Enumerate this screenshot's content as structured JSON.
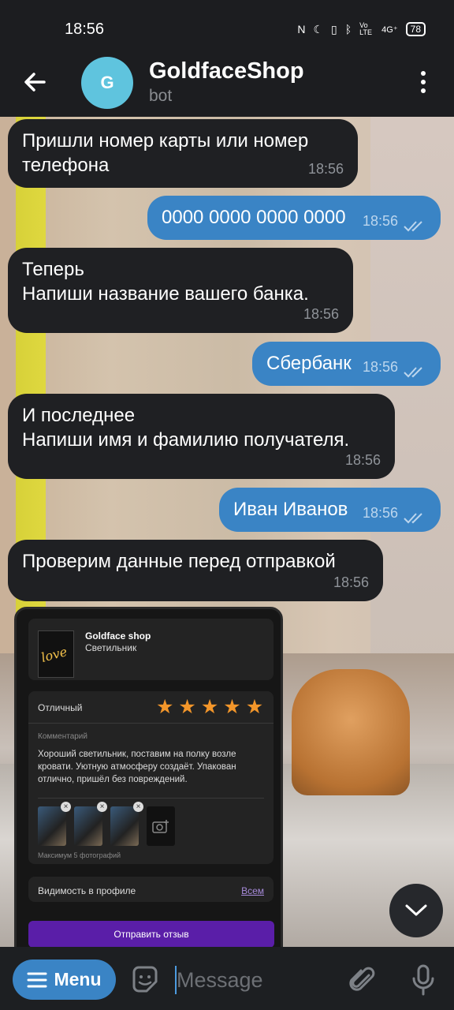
{
  "status_bar": {
    "time": "18:56",
    "network": "4G⁺",
    "volte": "Vo LTE",
    "battery": "78"
  },
  "header": {
    "avatar_letter": "G",
    "title": "GoldfaceShop",
    "subtitle": "bot"
  },
  "messages": [
    {
      "direction": "in",
      "text": "Пришли номер карты или номер\nтелефона",
      "time": "18:56"
    },
    {
      "direction": "out",
      "text": "0000 0000 0000 0000",
      "time": "18:56",
      "read": true
    },
    {
      "direction": "in",
      "text": "Теперь\nНапиши название вашего банка.",
      "time": "18:56"
    },
    {
      "direction": "out",
      "text": "Сбербанк",
      "time": "18:56",
      "read": true
    },
    {
      "direction": "in",
      "text": "И последнее\nНапиши имя и фамилию получателя.",
      "time": "18:56"
    },
    {
      "direction": "out",
      "text": "Иван Иванов",
      "time": "18:56",
      "read": true
    },
    {
      "direction": "in",
      "text": "Проверим данные перед отправкой",
      "time": "18:56"
    }
  ],
  "review_screenshot": {
    "product_image_text": "love",
    "shop": "Goldface shop",
    "item": "Светильник",
    "rating_label": "Отличный",
    "rating": 5,
    "rating_max": 5,
    "comment_label": "Комментарий",
    "comment": "Хороший светильник, поставим на полку возле кровати. Уютную атмосферу создаёт. Упакован отлично, пришёл без повреждений.",
    "photos_note": "Максимум 5 фотографий",
    "visibility_label": "Видимость в профиле",
    "visibility_value": "Всем",
    "submit_label": "Отправить отзыв"
  },
  "input_bar": {
    "menu_label": "Menu",
    "placeholder": "Message"
  },
  "colors": {
    "accent": "#3a84c5",
    "incoming_bubble": "#1f2023",
    "avatar": "#5fc4de",
    "star": "#f3962a",
    "submit": "#5a1ea8"
  }
}
